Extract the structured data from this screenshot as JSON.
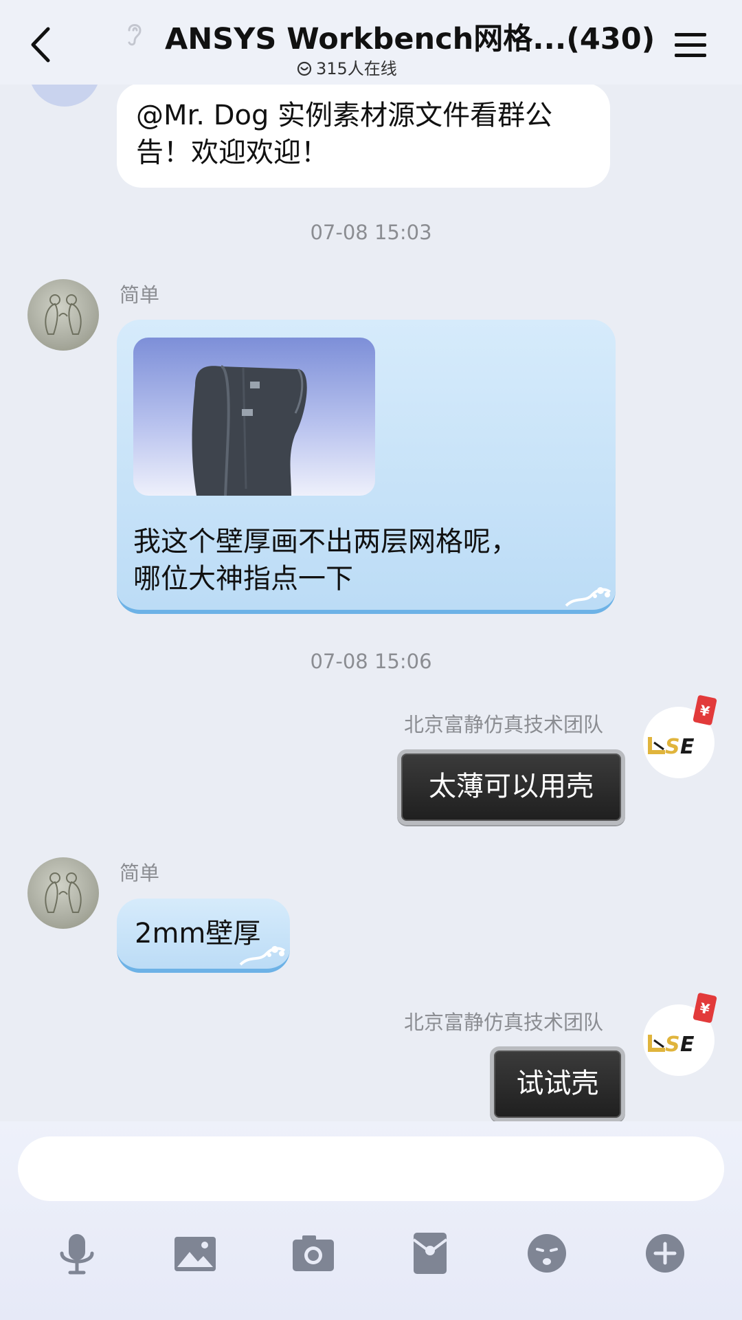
{
  "header": {
    "title": "ANSYS Workbench网格...",
    "member_count": "(430)",
    "online_text": "315人在线"
  },
  "messages": {
    "m1_text": "@Mr. Dog 实例素材源文件看群公告！欢迎欢迎！",
    "ts1": "07-08 15:03",
    "m2_sender": "简单",
    "m2_text_line1": "我这个壁厚画不出两层网格呢，",
    "m2_text_line2": "哪位大神指点一下",
    "ts2": "07-08 15:06",
    "m3_sender": "北京富静仿真技术团队",
    "m3_text": "太薄可以用壳",
    "m4_sender": "简单",
    "m4_text": "2mm壁厚",
    "m5_sender": "北京富静仿真技术团队",
    "m5_text": "试试壳"
  },
  "avatar_right": {
    "logo_text": "USE",
    "badge": "¥"
  },
  "input": {
    "placeholder": ""
  },
  "toolbar": {
    "icons": [
      "microphone-icon",
      "image-icon",
      "camera-icon",
      "red-packet-icon",
      "emoji-icon",
      "plus-icon"
    ]
  },
  "colors": {
    "background": "#eaedf4",
    "blue_bubble": "#bcdcf6",
    "dark_bubble": "#2a2a2a",
    "icon_gray": "#7f8594"
  }
}
